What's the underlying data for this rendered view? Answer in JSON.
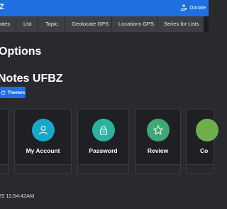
{
  "header": {
    "app_logo": "Z",
    "donate_label": "Donate"
  },
  "nav": {
    "items": [
      {
        "id": "notes",
        "label": "otes"
      },
      {
        "id": "list",
        "label": "List"
      },
      {
        "id": "topic",
        "label": "Topic"
      },
      {
        "id": "geolocate",
        "label": "Geolocate GPS"
      },
      {
        "id": "locations",
        "label": "Locations GPS"
      },
      {
        "id": "series",
        "label": "Series for Lists"
      }
    ]
  },
  "page": {
    "heading": "Options",
    "subheading": "Notes UFBZ",
    "themes_button": "Themes"
  },
  "cards": [
    {
      "id": "my-account",
      "label": "My Account",
      "icon": "user-icon",
      "color": "#1aa6c9"
    },
    {
      "id": "password",
      "label": "Password",
      "icon": "lock-icon",
      "color": "#2bb3a0"
    },
    {
      "id": "review",
      "label": "Review",
      "icon": "star-icon",
      "color": "#3ea876"
    },
    {
      "id": "co",
      "label": "Co",
      "icon": "",
      "color": "#6fae4a"
    }
  ],
  "footer": {
    "timestamp": "25 11:54:42AM"
  }
}
